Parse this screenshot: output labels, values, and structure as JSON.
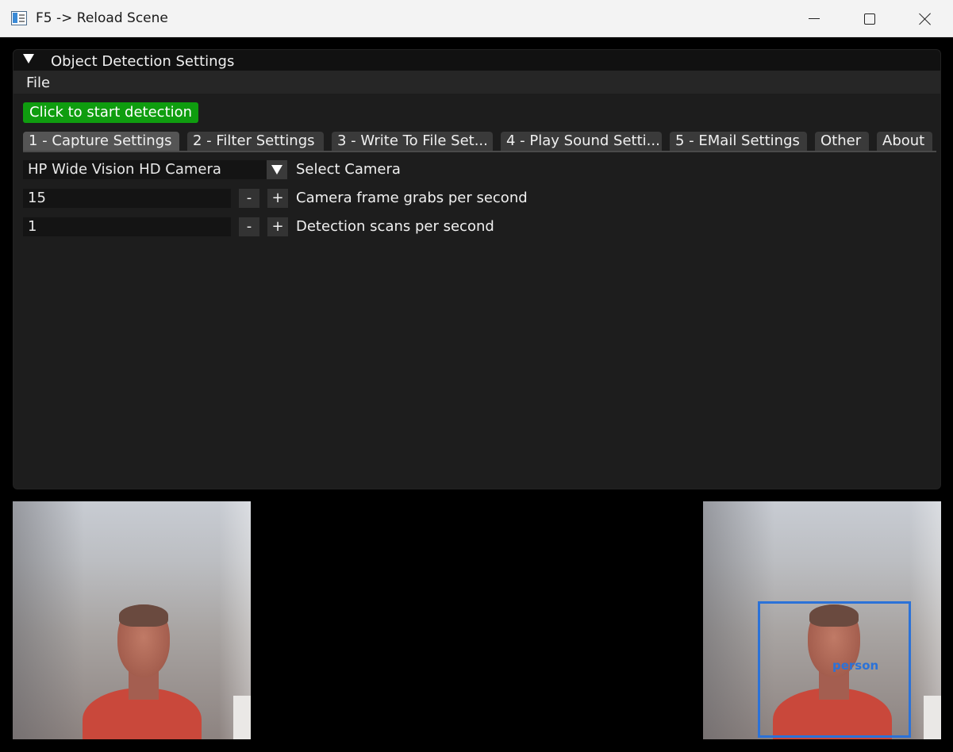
{
  "window": {
    "title": "F5 -> Reload Scene"
  },
  "panel": {
    "title": "Object Detection Settings",
    "menu": {
      "file_label": "File"
    },
    "start_button_label": "Click to start detection",
    "tabs": [
      {
        "label": "1 - Capture Settings",
        "active": true
      },
      {
        "label": "2 - Filter Settings"
      },
      {
        "label": "3 - Write To File Set..."
      },
      {
        "label": "4 - Play Sound Setti..."
      },
      {
        "label": "5 - EMail Settings"
      },
      {
        "label": "Other"
      },
      {
        "label": "About"
      }
    ],
    "camera_select": {
      "value": "HP Wide Vision HD Camera",
      "label": "Select Camera"
    },
    "frame_grabs": {
      "value": "15",
      "minus": "-",
      "plus": "+",
      "label": "Camera frame grabs per second"
    },
    "detection_scans": {
      "value": "1",
      "minus": "-",
      "plus": "+",
      "label": "Detection scans per second"
    }
  },
  "views": {
    "detection_label": "person"
  },
  "colors": {
    "start_button": "#0f9d0f",
    "detection_box": "#2b72d8",
    "panel_bg": "#1d1d1d"
  }
}
